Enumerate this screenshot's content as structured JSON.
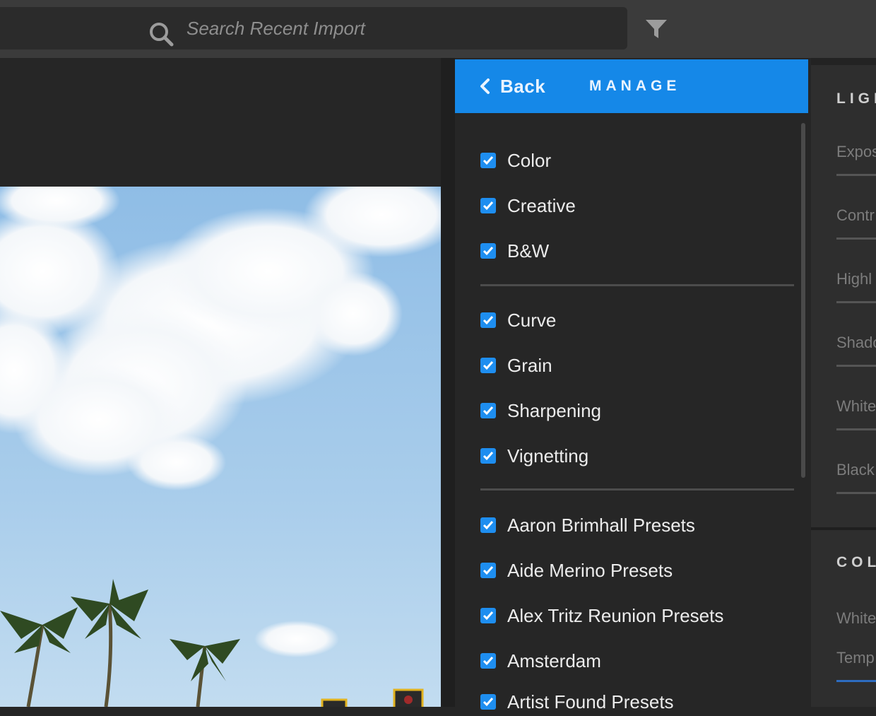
{
  "search": {
    "placeholder": "Search Recent Import"
  },
  "manage": {
    "back_label": "Back",
    "title": "MANAGE",
    "groups": [
      [
        {
          "label": "Color",
          "checked": true
        },
        {
          "label": "Creative",
          "checked": true
        },
        {
          "label": "B&W",
          "checked": true
        }
      ],
      [
        {
          "label": "Curve",
          "checked": true
        },
        {
          "label": "Grain",
          "checked": true
        },
        {
          "label": "Sharpening",
          "checked": true
        },
        {
          "label": "Vignetting",
          "checked": true
        }
      ],
      [
        {
          "label": "Aaron Brimhall Presets",
          "checked": true
        },
        {
          "label": "Aide Merino Presets",
          "checked": true
        },
        {
          "label": "Alex Tritz Reunion Presets",
          "checked": true
        },
        {
          "label": "Amsterdam",
          "checked": true
        },
        {
          "label": "Artist Found Presets",
          "checked": true
        }
      ]
    ]
  },
  "edit_panel": {
    "light_title": "LIGH",
    "light_sliders": [
      "Expos",
      "Contr",
      "Highl",
      "Shado",
      "White",
      "Black"
    ],
    "color_title": "COL",
    "color_sliders": [
      "White",
      "Temp"
    ]
  },
  "colors": {
    "accent": "#1588e8",
    "checkbox": "#1e8ef0",
    "panel_bg": "#262626",
    "topbar_bg": "#3b3b3b"
  }
}
